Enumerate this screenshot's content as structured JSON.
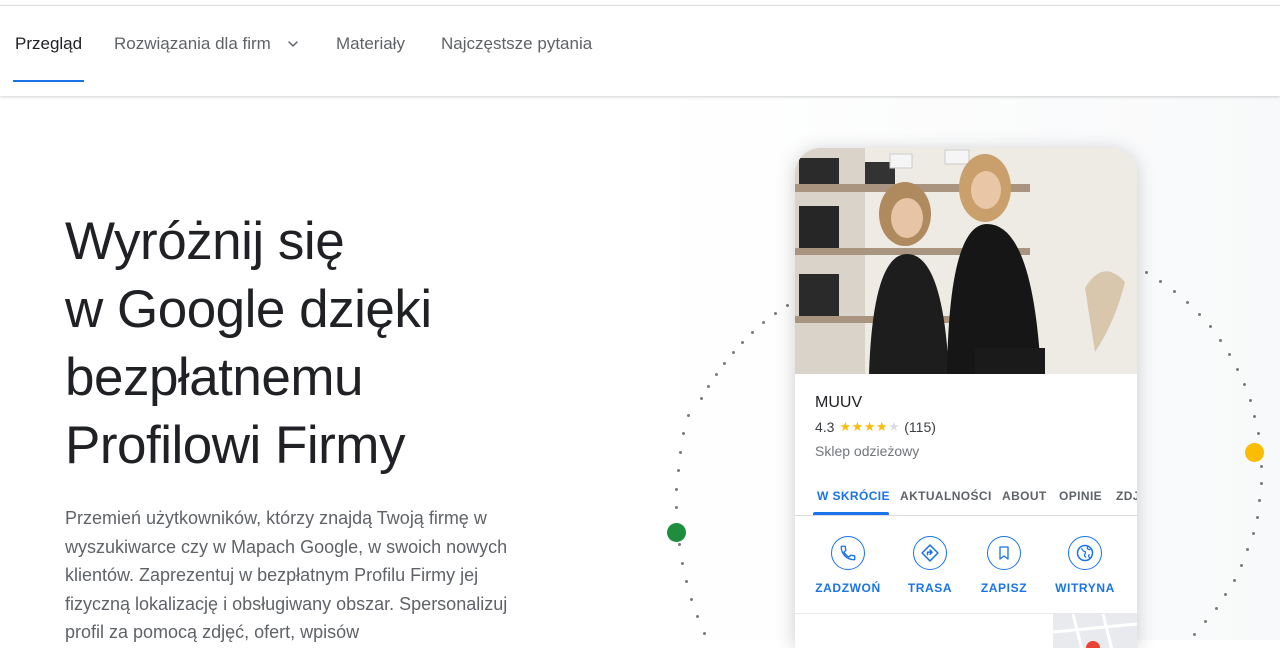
{
  "nav": {
    "items": [
      {
        "label": "Przegląd",
        "active": true
      },
      {
        "label": "Rozwiązania dla firm",
        "has_dropdown": true
      },
      {
        "label": "Materiały"
      },
      {
        "label": "Najczęstsze pytania"
      }
    ]
  },
  "hero": {
    "title_lines": [
      "Wyróżnij się",
      "w Google dzięki",
      "bezpłatnemu",
      "Profilowi Firmy"
    ],
    "description": "Przemień użytkowników, którzy znajdą Twoją firmę w wyszukiwarce czy w Mapach Google, w swoich nowych klientów. Zaprezentuj w bezpłatnym Profilu Firmy jej fizyczną lokalizację i obsługiwany obszar. Spersonalizuj profil za pomocą zdjęć, ofert, wpisów"
  },
  "profile_card": {
    "business_name": "MUUV",
    "rating": "4.3",
    "stars": {
      "value": 4.3,
      "max": 5
    },
    "review_count": "(115)",
    "category": "Sklep odzieżowy",
    "tabs": [
      {
        "label": "W SKRÓCIE",
        "active": true
      },
      {
        "label": "AKTUALNOŚCI"
      },
      {
        "label": "ABOUT"
      },
      {
        "label": "OPINIE"
      },
      {
        "label": "ZDJ"
      }
    ],
    "actions": [
      {
        "label": "ZADZWOŃ",
        "icon": "phone-icon"
      },
      {
        "label": "TRASA",
        "icon": "directions-icon"
      },
      {
        "label": "ZAPISZ",
        "icon": "bookmark-icon"
      },
      {
        "label": "WITRYNA",
        "icon": "globe-icon"
      }
    ]
  },
  "colors": {
    "accent": "#1a73e8",
    "star": "#fbbc04",
    "green_dot": "#1e8e3e",
    "yellow_dot": "#fbbc04"
  }
}
